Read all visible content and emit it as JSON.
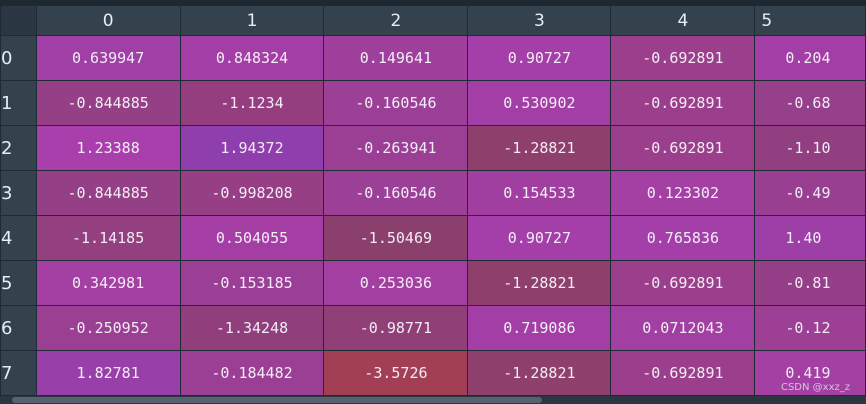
{
  "columns": [
    "0",
    "1",
    "2",
    "3",
    "4",
    "5"
  ],
  "rows": [
    {
      "index": "0",
      "values": [
        "0.639947",
        "0.848324",
        "0.149641",
        "0.90727",
        "-0.692891",
        "0.204"
      ]
    },
    {
      "index": "1",
      "values": [
        "-0.844885",
        "-1.1234",
        "-0.160546",
        "0.530902",
        "-0.692891",
        "-0.68"
      ]
    },
    {
      "index": "2",
      "values": [
        "1.23388",
        "1.94372",
        "-0.263941",
        "-1.28821",
        "-0.692891",
        "-1.10"
      ]
    },
    {
      "index": "3",
      "values": [
        "-0.844885",
        "-0.998208",
        "-0.160546",
        "0.154533",
        "0.123302",
        "-0.49"
      ]
    },
    {
      "index": "4",
      "values": [
        "-1.14185",
        "0.504055",
        "-1.50469",
        "0.90727",
        "0.765836",
        "1.40"
      ]
    },
    {
      "index": "5",
      "values": [
        "0.342981",
        "-0.153185",
        "0.253036",
        "-1.28821",
        "-0.692891",
        "-0.81"
      ]
    },
    {
      "index": "6",
      "values": [
        "-0.250952",
        "-1.34248",
        "-0.98771",
        "0.719086",
        "0.0712043",
        "-0.12"
      ]
    },
    {
      "index": "7",
      "values": [
        "1.82781",
        "-0.184482",
        "-3.5726",
        "-1.28821",
        "-0.692891",
        "0.419"
      ]
    }
  ],
  "cell_colors": [
    [
      "#a03fa6",
      "#a43ea7",
      "#9e3f9c",
      "#a43ea8",
      "#9b3f8c",
      "#a43ea7"
    ],
    [
      "#953f86",
      "#943e80",
      "#9b3f97",
      "#a43ea7",
      "#9b3f8c",
      "#963f8b"
    ],
    [
      "#a93fad",
      "#8e3ead",
      "#9b3f95",
      "#8e3f6b",
      "#9b3f8c",
      "#913f80"
    ],
    [
      "#953f86",
      "#963f85",
      "#9b3f97",
      "#a13fa1",
      "#a43fa3",
      "#983f91"
    ],
    [
      "#933f80",
      "#a43ea5",
      "#8b3f6c",
      "#a43ea8",
      "#a43fa9",
      "#9e3fa8"
    ],
    [
      "#a43fa4",
      "#9b3f96",
      "#a43fa2",
      "#8e3f6b",
      "#9b3f8c",
      "#943f88"
    ],
    [
      "#9a3f92",
      "#903f7c",
      "#913f77",
      "#a43ea7",
      "#a23fa2",
      "#9c3f95"
    ],
    [
      "#993faa",
      "#9a3f93",
      "#a33f54",
      "#8e3f6b",
      "#9b3f8c",
      "#a43fa4"
    ]
  ],
  "watermark": "CSDN @xxz_z",
  "colors": {
    "header_bg": "#34424e",
    "border": "#1e2a34",
    "text": "#f3edf6"
  }
}
